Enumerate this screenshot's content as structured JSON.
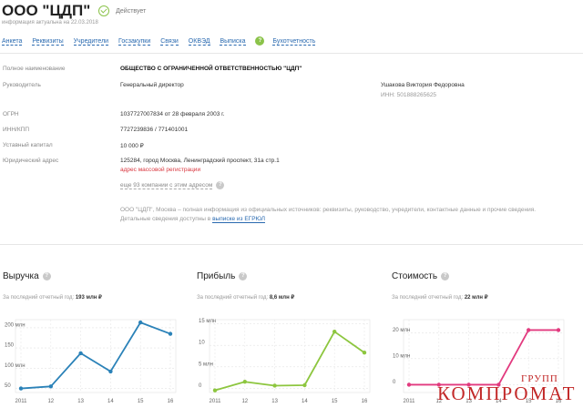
{
  "company": {
    "name": "ООО \"ЦДП\"",
    "status": "Действует",
    "subtitle": "информация актуальна на 22.03.2018"
  },
  "tabs": [
    "Анкета",
    "Реквизиты",
    "Учредители",
    "Госзакупки",
    "Связи",
    "ОКВЭД",
    "Выписка",
    "Бухотчетность"
  ],
  "tabs_badge": "?",
  "info": {
    "full_name_label": "Полное наименование",
    "full_name": "ОБЩЕСТВО С ОГРАНИЧЕННОЙ ОТВЕТСТВЕННОСТЬЮ \"ЦДП\"",
    "head_label": "Руководитель",
    "head_position": "Генеральный директор",
    "head_name": "Ушакова Виктория Федоровна",
    "head_inn": "ИНН: 501888265625",
    "ogrn_label": "ОГРН",
    "ogrn": "1037727007834 от 28 февраля 2003 г.",
    "innkpp_label": "ИНН/КПП",
    "innkpp": "7727239836 / 771401001",
    "capital_label": "Уставный капитал",
    "capital": "10 000 ₽",
    "address_label": "Юридический адрес",
    "address": "125284, город Москва, Ленинградский проспект, 31а стр.1",
    "address_warning": "адрес массовой регистрации",
    "address_more": "еще 93 компании с этим адресом",
    "note": "ООО \"ЦДП\", Москва – полная информация из официальных источников: реквизиты, руководство, учредители, контактные данные и прочие сведения. Детальные сведения доступны в",
    "note_link": "выписке из ЕГРЮЛ"
  },
  "finance": [
    {
      "title": "Выручка",
      "sub": "За последний отчетный год:",
      "value": "193 млн ₽"
    },
    {
      "title": "Прибыль",
      "sub": "За последний отчетный год:",
      "value": "8,6 млн ₽"
    },
    {
      "title": "Стоимость",
      "sub": "За последний отчетный год:",
      "value": "22 млн ₽"
    }
  ],
  "chart_data": [
    {
      "type": "line",
      "x": [
        "2011",
        "12",
        "13",
        "14",
        "15",
        "16"
      ],
      "y_ticks": [
        "50",
        "100 млн",
        "150",
        "200 млн"
      ],
      "ylim": [
        40,
        220
      ],
      "values": [
        50,
        55,
        137,
        92,
        213,
        185
      ],
      "color": "#2b82b8",
      "grid": true
    },
    {
      "type": "line",
      "x": [
        "2011",
        "12",
        "13",
        "14",
        "15",
        "16"
      ],
      "y_ticks": [
        "0",
        "5 млн",
        "10",
        "15 млн"
      ],
      "ylim": [
        -1,
        16
      ],
      "values": [
        -0.5,
        1.5,
        0.6,
        0.7,
        13.2,
        8.3
      ],
      "color": "#8dc63f",
      "grid": true
    },
    {
      "type": "line",
      "x": [
        "2011",
        "12",
        "13",
        "14",
        "15",
        "16"
      ],
      "y_ticks": [
        "0",
        "10 млн",
        "20 млн"
      ],
      "ylim": [
        -3,
        25
      ],
      "values": [
        0,
        0,
        0,
        0,
        21,
        21
      ],
      "color": "#e23a7f",
      "grid": true
    }
  ],
  "watermark": {
    "top": "ГРУПП",
    "main": "КОМПРОМАТ"
  }
}
